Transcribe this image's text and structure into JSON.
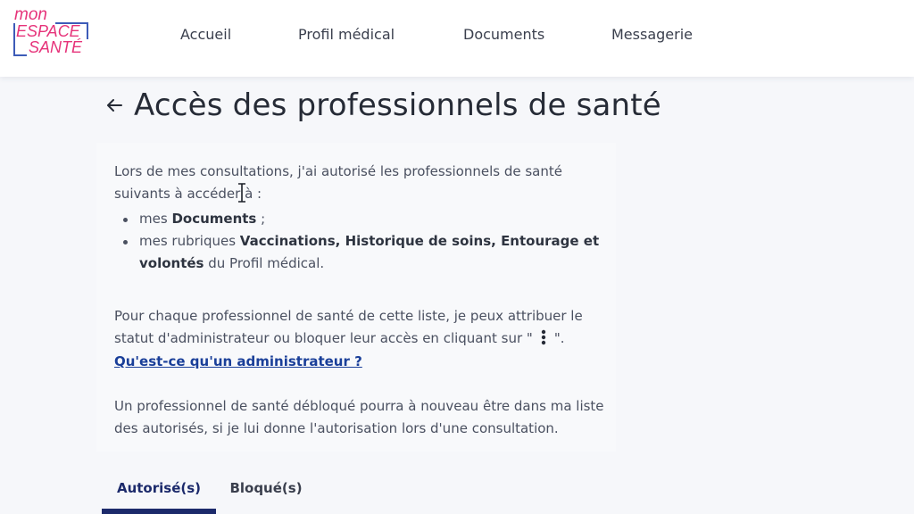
{
  "header": {
    "logo": {
      "line1": "mon",
      "line2": "ESPACE",
      "line3": "SANTÉ",
      "color": "#e6337a",
      "accent": "#3d5bb8"
    },
    "nav": [
      {
        "label": "Accueil"
      },
      {
        "label": "Profil médical"
      },
      {
        "label": "Documents"
      },
      {
        "label": "Messagerie"
      }
    ]
  },
  "page": {
    "back_icon": "arrow-left-icon",
    "title": "Accès des professionnels de santé"
  },
  "content": {
    "intro": "Lors de mes consultations, j'ai autorisé les professionnels de santé suivants à accéder à :",
    "bullet1_prefix": "mes ",
    "bullet1_bold": "Documents",
    "bullet1_suffix": " ;",
    "bullet2_prefix": "mes rubriques ",
    "bullet2_bold": "Vaccinations, Historique de soins, Entourage et volontés",
    "bullet2_suffix": " du Profil médical.",
    "para2_before": "Pour chaque professionnel de santé de cette liste, je peux attribuer le statut d'administrateur ou bloquer leur accès en cliquant sur \"",
    "para2_icon": "kebab-menu-icon",
    "para2_after": "\".",
    "admin_link": "Qu'est-ce qu'un administrateur ?",
    "para3": "Un professionnel de santé débloqué pourra à nouveau être dans ma liste des autorisés, si je lui donne l'autorisation lors d'une consultation."
  },
  "tabs": [
    {
      "label": "Autorisé(s)",
      "active": true
    },
    {
      "label": "Bloqué(s)",
      "active": false
    }
  ],
  "colors": {
    "primary": "#1c2a6b",
    "link": "#1a3f99",
    "brand_pink": "#e6337a"
  }
}
